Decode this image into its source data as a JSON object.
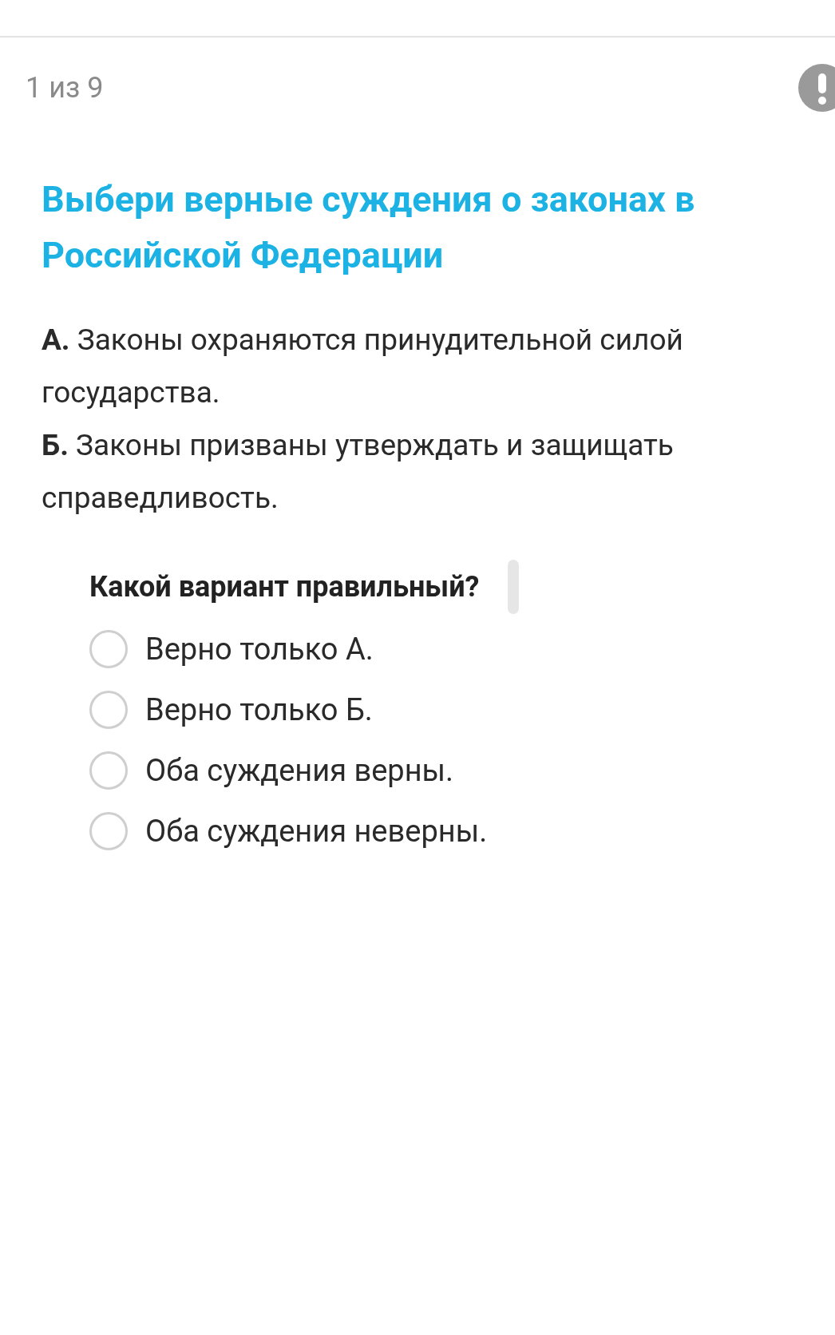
{
  "progress": "1 из 9",
  "title": "Выбери верные суждения о законах в Российской Федерации",
  "statements": [
    "**А.** Законы охраняются принудительной силой государства.",
    "**Б.** Законы призваны утверждать и защищать справедливость."
  ],
  "question": "Какой вариант правильный?",
  "options": [
    {
      "label": "Верно только А.",
      "selected": false
    },
    {
      "label": "Верно только Б.",
      "selected": false
    },
    {
      "label": "Оба суждения верны.",
      "selected": false
    },
    {
      "label": "Оба суждения неверны.",
      "selected": false
    }
  ]
}
